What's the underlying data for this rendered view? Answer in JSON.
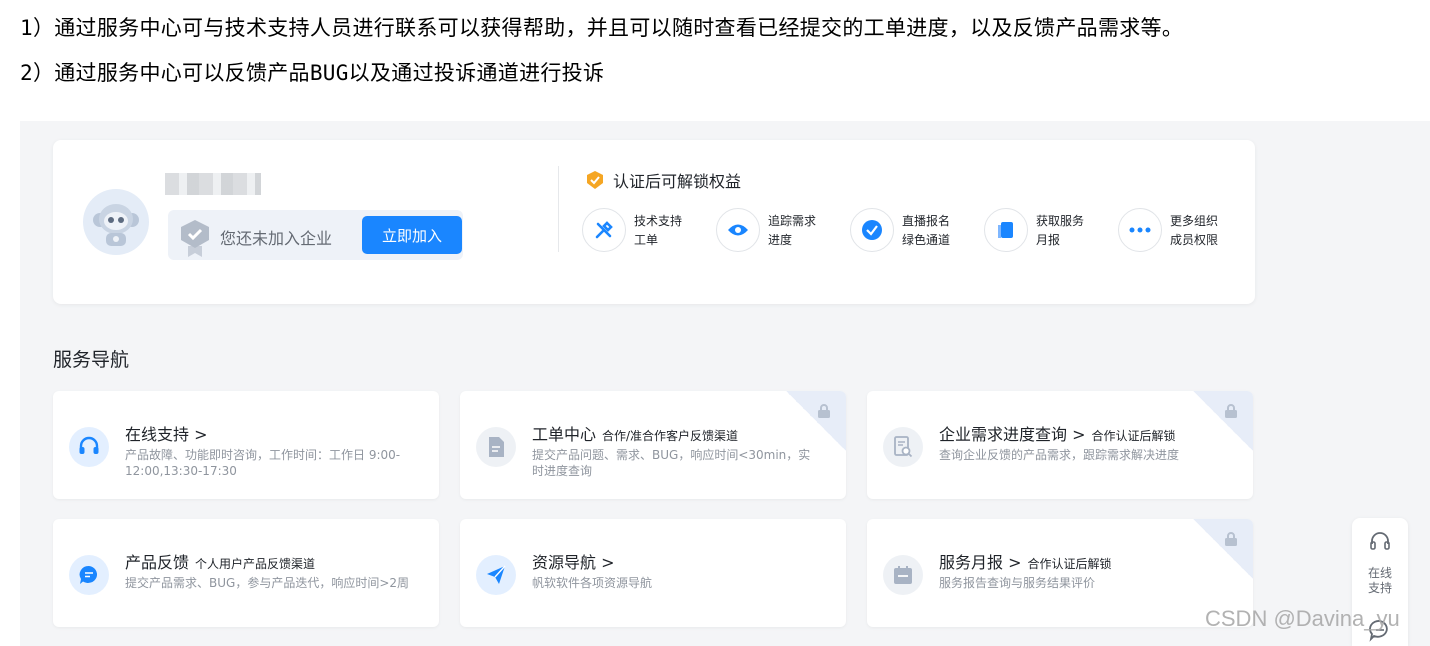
{
  "intro": {
    "line1": "1）通过服务中心可与技术支持人员进行联系可以获得帮助，并且可以随时查看已经提交的工单进度，以及反馈产品需求等。",
    "line2": "2）通过服务中心可以反馈产品BUG以及通过投诉通道进行投诉"
  },
  "profile": {
    "join_prompt": "您还未加入企业",
    "join_button": "立即加入",
    "benefits_title": "认证后可解锁权益",
    "benefits": [
      {
        "icon": "wrench-icon",
        "line1": "技术支持",
        "line2": "工单"
      },
      {
        "icon": "eye-icon",
        "line1": "追踪需求",
        "line2": "进度"
      },
      {
        "icon": "check-circle-icon",
        "line1": "直播报名",
        "line2": "绿色通道"
      },
      {
        "icon": "report-icon",
        "line1": "获取服务",
        "line2": "月报"
      },
      {
        "icon": "more-icon",
        "line1": "更多组织",
        "line2": "成员权限"
      }
    ]
  },
  "service_nav": {
    "title": "服务导航",
    "cards": [
      {
        "title": "在线支持 >",
        "tag": "",
        "desc": "产品故障、功能即时咨询，工作时间：工作日 9:00-12:00,13:30-17:30",
        "locked": false,
        "icon": "headset-icon",
        "icon_color": "#1a86ff"
      },
      {
        "title": "工单中心",
        "tag": "合作/准合作客户反馈渠道",
        "desc": "提交产品问题、需求、BUG，响应时间<30min，实时进度查询",
        "locked": true,
        "icon": "document-icon",
        "icon_color": "#a8b3c4"
      },
      {
        "title": "企业需求进度查询 >",
        "tag": "合作认证后解锁",
        "desc": "查询企业反馈的产品需求，跟踪需求解决进度",
        "locked": true,
        "icon": "search-doc-icon",
        "icon_color": "#a8b3c4"
      },
      {
        "title": "产品反馈",
        "tag": "个人用户产品反馈渠道",
        "desc": "提交产品需求、BUG，参与产品迭代，响应时间>2周",
        "locked": false,
        "icon": "chat-icon",
        "icon_color": "#1a86ff"
      },
      {
        "title": "资源导航 >",
        "tag": "",
        "desc": "帆软软件各项资源导航",
        "locked": false,
        "icon": "paper-plane-icon",
        "icon_color": "#1a86ff"
      },
      {
        "title": "服务月报 >",
        "tag": "合作认证后解锁",
        "desc": "服务报告查询与服务结果评价",
        "locked": true,
        "icon": "calendar-icon",
        "icon_color": "#a8b3c4"
      }
    ]
  },
  "floating": {
    "label_line1": "在线",
    "label_line2": "支持"
  },
  "watermark": "CSDN @Davina_yu",
  "colors": {
    "accent": "#1a86ff",
    "background": "#f4f5f7",
    "card": "#ffffff",
    "muted": "#8f959e"
  }
}
